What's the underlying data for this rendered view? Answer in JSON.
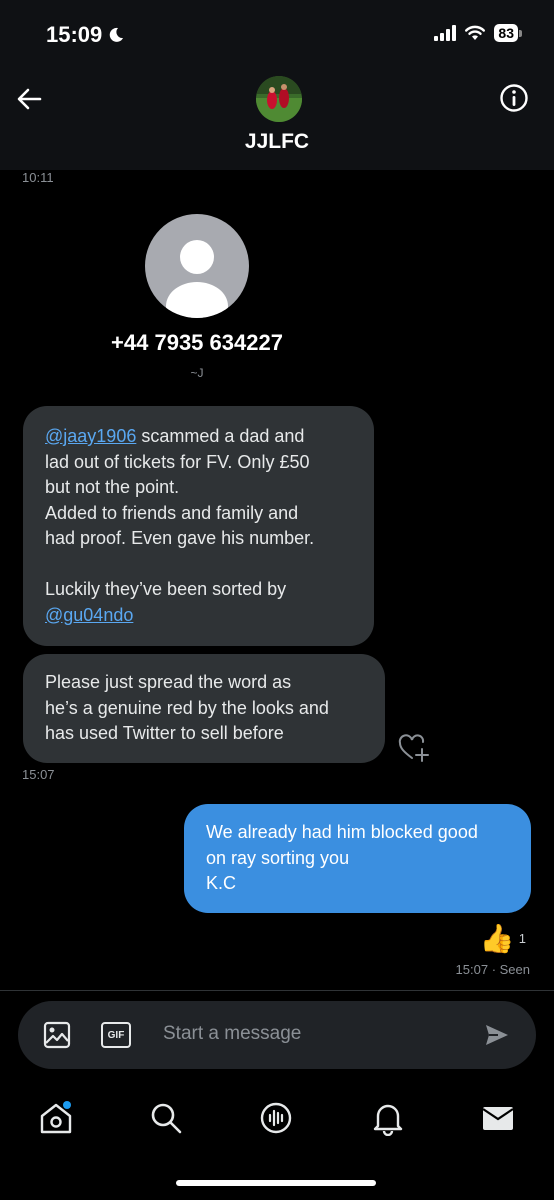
{
  "status_bar": {
    "time": "15:09",
    "battery": "83"
  },
  "header": {
    "group_name": "JJLFC"
  },
  "messages": {
    "timestamp_top": "10:11",
    "contact": {
      "phone": "+44 7935 634227",
      "alias": "~J"
    },
    "msg1": {
      "mention1": "@jaay1906",
      "line1_rest": " scammed a dad and",
      "line2": "lad out of tickets for FV. Only £50",
      "line3": "but not the point.",
      "line4": "Added to friends and family and",
      "line5": "had proof. Even gave his number.",
      "line6": "Luckily they’ve been sorted by",
      "mention2": "@gu04ndo"
    },
    "msg2": {
      "line1": "Please just spread the word as",
      "line2": "he’s a genuine red by the looks and",
      "line3": "has used Twitter to sell before"
    },
    "timestamp_incoming": "15:07",
    "msg3": {
      "line1": "We already had him blocked good",
      "line2": "on ray sorting you",
      "line3": "K.C"
    },
    "reaction": {
      "emoji": "👍",
      "count": "1"
    },
    "seen": "15:07 · Seen"
  },
  "composer": {
    "placeholder": "Start a message",
    "gif_label": "GIF"
  },
  "nav": {
    "items": [
      "home-icon",
      "search-icon",
      "spaces-icon",
      "notifications-icon",
      "messages-icon"
    ]
  },
  "colors": {
    "outgoing_bubble": "#3b8fe0",
    "incoming_bubble": "#2f3336",
    "link": "#5aa8f2"
  }
}
